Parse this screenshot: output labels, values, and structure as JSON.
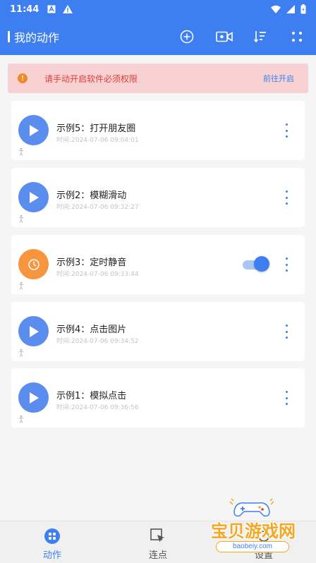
{
  "status_bar": {
    "time": "11:44",
    "left_icons": [
      "a-box-icon",
      "warning-icon"
    ],
    "right_icons": [
      "wifi-icon",
      "signal-icon",
      "battery-icon"
    ]
  },
  "app_bar": {
    "title": "我的动作",
    "actions": [
      "add-circle-icon",
      "record-video-icon",
      "sort-icon",
      "grid-icon"
    ]
  },
  "warning_banner": {
    "text": "请手动开启软件必须权限",
    "link": "前往开启"
  },
  "actions": [
    {
      "name": "示例5：打开朋友圈",
      "time": "时间:2024-07-06 09:04:01",
      "icon": "play-icon",
      "toggle": false
    },
    {
      "name": "示例2：模糊滑动",
      "time": "时间:2024-07-06 09:32:27",
      "icon": "play-icon",
      "toggle": false
    },
    {
      "name": "示例3：定时静音",
      "time": "时间:2024-07-06 09:33:44",
      "icon": "clock-icon",
      "toggle": true
    },
    {
      "name": "示例4：点击图片",
      "time": "时间:2024-07-06 09:34:52",
      "icon": "play-icon",
      "toggle": false
    },
    {
      "name": "示例1：模拟点击",
      "time": "时间:2024-07-06 09:36:56",
      "icon": "play-icon",
      "toggle": false
    }
  ],
  "bottom_nav": [
    {
      "label": "动作",
      "active": true,
      "icon": "grid-circle-icon"
    },
    {
      "label": "连点",
      "active": false,
      "icon": "cursor-icon"
    },
    {
      "label": "设置",
      "active": false,
      "icon": "settings-icon"
    }
  ],
  "watermark": {
    "text": "宝贝游戏网",
    "sub": "baobeiy.com"
  },
  "colors": {
    "primary": "#3d7ff0",
    "warning_bg": "#f8d2d2",
    "warning_text": "#e03c3c",
    "play_blue": "#5b8def",
    "clock_orange": "#f7953f"
  }
}
